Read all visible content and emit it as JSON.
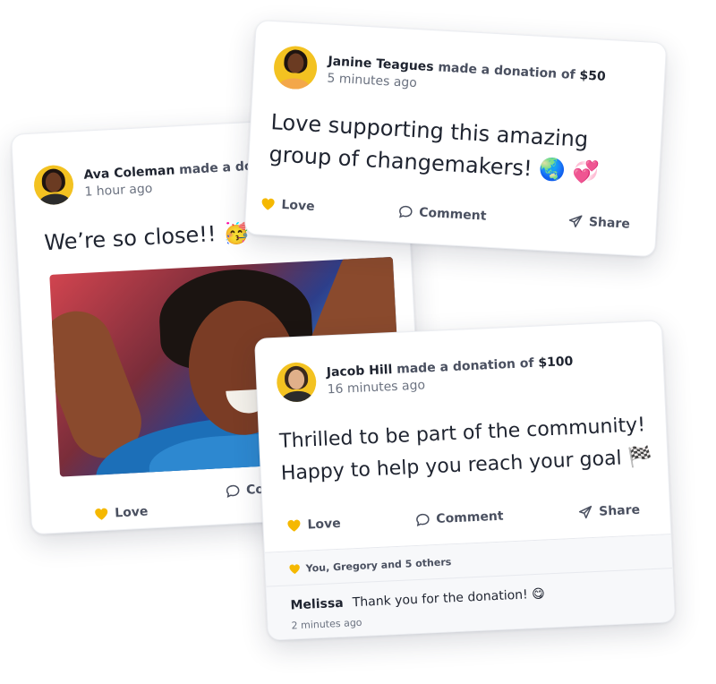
{
  "cards": {
    "ava": {
      "name": "Ava Coleman",
      "action": "made a dona",
      "time": "1 hour ago",
      "message": "We’re so close!! 🥳",
      "love_label": "Love",
      "comment_label": "Comme",
      "avatar_color": "#f3c221"
    },
    "janine": {
      "name": "Janine Teagues",
      "action": "made a donation of",
      "amount": "$50",
      "time": "5 minutes ago",
      "message_line1": "Love supporting this amazing",
      "message_line2": "group of changemakers! 🌏 💞",
      "love_label": "Love",
      "comment_label": "Comment",
      "share_label": "Share",
      "avatar_color": "#f3c221"
    },
    "jacob": {
      "name": "Jacob Hill",
      "action": "made a donation of",
      "amount": "$100",
      "time": "16 minutes ago",
      "message_line1": "Thrilled to be part of the community!",
      "message_line2": "Happy to help you reach your goal 🏁",
      "love_label": "Love",
      "comment_label": "Comment",
      "share_label": "Share",
      "likes_names": "You, Gregory",
      "likes_and": "and",
      "likes_others": "5 others",
      "comment_author": "Melissa",
      "comment_text": "Thank you for the donation! 😋",
      "comment_time": "2 minutes ago",
      "avatar_color": "#f3c221"
    }
  },
  "colors": {
    "heart": "#f5b800",
    "muted_text": "#4a5060",
    "card_bg": "#ffffff"
  },
  "icons": {
    "love": "heart-icon",
    "comment": "speech-bubble-icon",
    "share": "paper-plane-icon"
  }
}
